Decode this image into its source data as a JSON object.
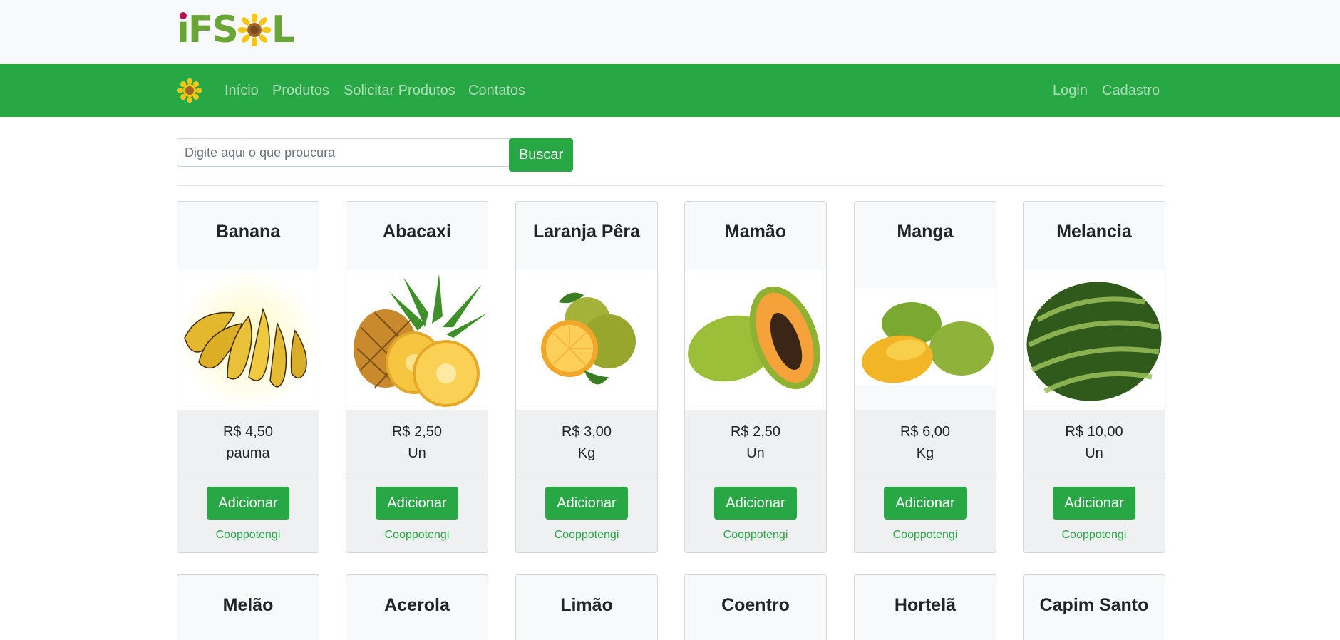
{
  "brand": {
    "logo_text": "iFSOL",
    "logo_icon": "sunflower-icon",
    "colors": {
      "primary": "#28a745",
      "logo_green": "#6aa636",
      "logo_dot": "#b3124e",
      "sun_yellow": "#f5c518",
      "sun_center": "#a0632a"
    }
  },
  "nav": {
    "links": [
      "Início",
      "Produtos",
      "Solicitar Produtos",
      "Contatos"
    ],
    "right_links": [
      "Login",
      "Cadastro"
    ]
  },
  "search": {
    "placeholder": "Digite aqui o que proucura",
    "value": "",
    "button_label": "Buscar"
  },
  "products": [
    {
      "name": "Banana",
      "price": "R$ 4,50",
      "unit": "pauma",
      "add_label": "Adicionar",
      "vendor": "Cooppotengi",
      "image_icon": "banana-image"
    },
    {
      "name": "Abacaxi",
      "price": "R$ 2,50",
      "unit": "Un",
      "add_label": "Adicionar",
      "vendor": "Cooppotengi",
      "image_icon": "pineapple-image"
    },
    {
      "name": "Laranja Pêra",
      "price": "R$ 3,00",
      "unit": "Kg",
      "add_label": "Adicionar",
      "vendor": "Cooppotengi",
      "image_icon": "orange-image"
    },
    {
      "name": "Mamão",
      "price": "R$ 2,50",
      "unit": "Un",
      "add_label": "Adicionar",
      "vendor": "Cooppotengi",
      "image_icon": "papaya-image"
    },
    {
      "name": "Manga",
      "price": "R$ 6,00",
      "unit": "Kg",
      "add_label": "Adicionar",
      "vendor": "Cooppotengi",
      "image_icon": "mango-image"
    },
    {
      "name": "Melancia",
      "price": "R$ 10,00",
      "unit": "Un",
      "add_label": "Adicionar",
      "vendor": "Cooppotengi",
      "image_icon": "watermelon-image"
    }
  ],
  "products_row2": [
    {
      "name": "Melão"
    },
    {
      "name": "Acerola"
    },
    {
      "name": "Limão"
    },
    {
      "name": "Coentro"
    },
    {
      "name": "Hortelã"
    },
    {
      "name": "Capim Santo"
    }
  ]
}
